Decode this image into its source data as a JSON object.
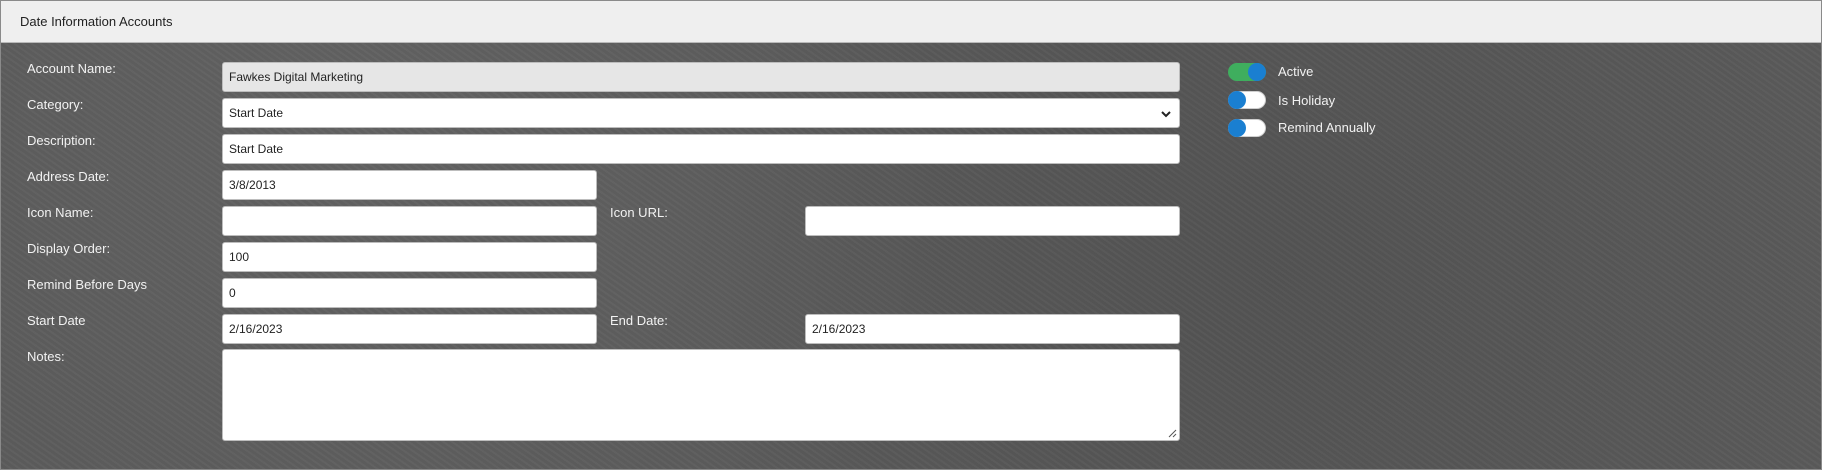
{
  "header": {
    "title": "Date Information Accounts"
  },
  "form": {
    "account_name": {
      "label": "Account Name:",
      "value": "Fawkes Digital Marketing"
    },
    "category": {
      "label": "Category:",
      "value": "Start Date"
    },
    "description": {
      "label": "Description:",
      "value": "Start Date"
    },
    "address_date": {
      "label": "Address Date:",
      "value": "3/8/2013"
    },
    "icon_name": {
      "label": "Icon Name:",
      "value": ""
    },
    "icon_url": {
      "label": "Icon URL:",
      "value": ""
    },
    "display_order": {
      "label": "Display Order:",
      "value": "100"
    },
    "remind_before_days": {
      "label": "Remind Before Days",
      "value": "0"
    },
    "start_date": {
      "label": "Start Date",
      "value": "2/16/2023"
    },
    "end_date": {
      "label": "End Date:",
      "value": "2/16/2023"
    },
    "notes": {
      "label": "Notes:",
      "value": ""
    }
  },
  "toggles": [
    {
      "label": "Active",
      "on": true
    },
    {
      "label": "Is Holiday",
      "on": false
    },
    {
      "label": "Remind Annually",
      "on": false
    }
  ],
  "colors": {
    "toggle_on": "#3fae5e",
    "knob": "#1a7fd1"
  }
}
